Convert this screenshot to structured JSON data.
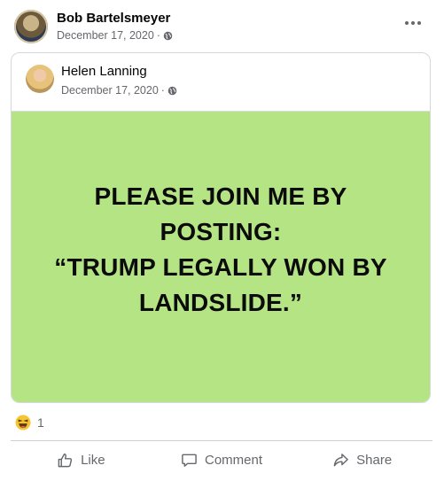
{
  "post": {
    "author": "Bob Bartelsmeyer",
    "date": "December 17, 2020",
    "separator": "·",
    "privacy_icon": "globe-icon",
    "more_icon": "more-options-icon"
  },
  "shared_post": {
    "author": "Helen Lanning",
    "date": "December 17, 2020",
    "separator": "·",
    "privacy_icon": "globe-icon",
    "background_color": "#b5e485",
    "text": "PLEASE JOIN ME BY\nPOSTING:\n“TRUMP LEGALLY WON BY\nLANDSLIDE.”"
  },
  "reactions": {
    "icon": "haha-emoji-icon",
    "count": "1"
  },
  "actions": {
    "like_label": "Like",
    "comment_label": "Comment",
    "share_label": "Share"
  }
}
